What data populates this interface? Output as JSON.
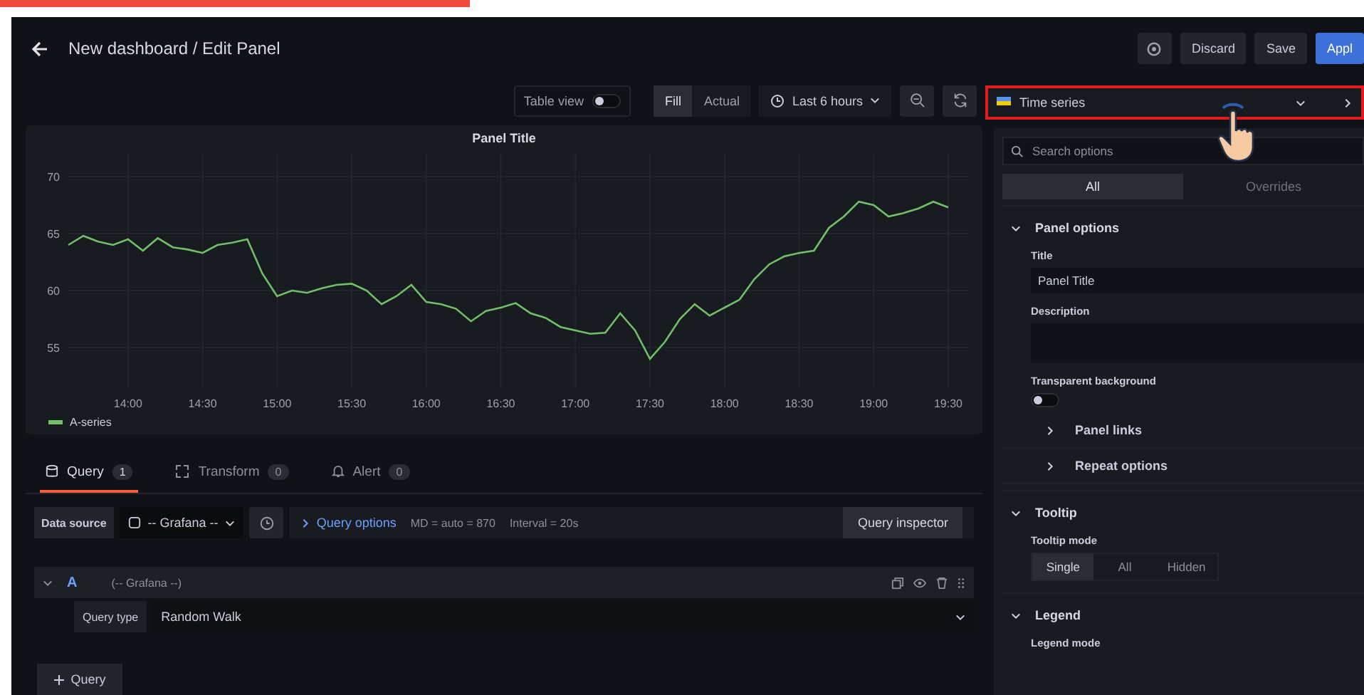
{
  "header": {
    "title": "New dashboard / Edit Panel",
    "buttons": [
      {
        "label": "Discard",
        "kind": "secondary"
      },
      {
        "label": "Save",
        "kind": "secondary"
      },
      {
        "label": "Appl",
        "kind": "primary"
      }
    ]
  },
  "toolbar": {
    "table_view": {
      "label": "Table view",
      "on": false
    },
    "size_modes": [
      {
        "label": "Fill",
        "selected": true
      },
      {
        "label": "Actual",
        "selected": false
      }
    ],
    "time_range": "Last 6 hours"
  },
  "visualization_picker": {
    "label": "Time series",
    "highlighted": true
  },
  "panel": {
    "title": "Panel Title",
    "chart_data": {
      "type": "line",
      "x": [
        13.6,
        13.7,
        13.8,
        13.9,
        14.0,
        14.1,
        14.2,
        14.3,
        14.4,
        14.5,
        14.6,
        14.7,
        14.8,
        14.9,
        15.0,
        15.1,
        15.2,
        15.3,
        15.4,
        15.5,
        15.6,
        15.7,
        15.8,
        15.9,
        16.0,
        16.1,
        16.2,
        16.3,
        16.4,
        16.5,
        16.6,
        16.7,
        16.8,
        16.9,
        17.0,
        17.1,
        17.2,
        17.3,
        17.4,
        17.5,
        17.6,
        17.7,
        17.8,
        17.9,
        18.0,
        18.1,
        18.2,
        18.3,
        18.4,
        18.5,
        18.6,
        18.7,
        18.8,
        18.9,
        19.0,
        19.1,
        19.2,
        19.3,
        19.4,
        19.5
      ],
      "series": [
        {
          "name": "A-series",
          "color": "#73bf69",
          "values": [
            64,
            64.8,
            64.3,
            64,
            64.5,
            63.5,
            64.6,
            63.8,
            63.6,
            63.3,
            64,
            64.2,
            64.5,
            61.5,
            59.5,
            60,
            59.8,
            60.2,
            60.5,
            60.6,
            60,
            58.8,
            59.5,
            60.5,
            59,
            58.8,
            58.4,
            57.3,
            58.2,
            58.5,
            58.9,
            58,
            57.6,
            56.8,
            56.5,
            56.2,
            56.3,
            58,
            56.5,
            54,
            55.5,
            57.5,
            58.8,
            57.8,
            58.5,
            59.2,
            61,
            62.3,
            63,
            63.3,
            63.5,
            65.5,
            66.5,
            67.8,
            67.5,
            66.5,
            66.8,
            67.2,
            67.8,
            67.3
          ]
        }
      ],
      "xlim": [
        13.6,
        19.5
      ],
      "ylim": [
        51.5,
        72
      ],
      "grid": true,
      "xticks": [
        {
          "value": 14,
          "label": "14:00"
        },
        {
          "value": 14.5,
          "label": "14:30"
        },
        {
          "value": 15,
          "label": "15:00"
        },
        {
          "value": 15.5,
          "label": "15:30"
        },
        {
          "value": 16,
          "label": "16:00"
        },
        {
          "value": 16.5,
          "label": "16:30"
        },
        {
          "value": 17,
          "label": "17:00"
        },
        {
          "value": 17.5,
          "label": "17:30"
        },
        {
          "value": 18,
          "label": "18:00"
        },
        {
          "value": 18.5,
          "label": "18:30"
        },
        {
          "value": 19,
          "label": "19:00"
        },
        {
          "value": 19.5,
          "label": "19:30"
        }
      ],
      "yticks": [
        55,
        60,
        65,
        70
      ]
    }
  },
  "query_tabs": [
    {
      "label": "Query",
      "count": "1",
      "selected": true
    },
    {
      "label": "Transform",
      "count": "0",
      "selected": false
    },
    {
      "label": "Alert",
      "count": "0",
      "selected": false
    }
  ],
  "data_source": {
    "label": "Data source",
    "value": "-- Grafana --",
    "query_options": "Query options",
    "meta": [
      "MD = auto = 870",
      "Interval = 20s"
    ],
    "inspector": "Query inspector"
  },
  "query": {
    "ref": "A",
    "source": "(-- Grafana --)",
    "expanded": true,
    "fields": [
      {
        "label": "Query type",
        "value": "Random Walk"
      }
    ]
  },
  "add_query": "Query",
  "options": {
    "search_placeholder": "Search options",
    "tabs": [
      {
        "label": "All",
        "selected": true
      },
      {
        "label": "Overrides",
        "selected": false
      }
    ],
    "sections": [
      {
        "title": "Panel options",
        "expanded": true,
        "items": [
          {
            "kind": "input",
            "label": "Title",
            "value": "Panel Title"
          },
          {
            "kind": "textarea",
            "label": "Description",
            "value": ""
          },
          {
            "kind": "switch",
            "label": "Transparent background",
            "on": false
          },
          {
            "kind": "sub",
            "label": "Panel links"
          },
          {
            "kind": "sub",
            "label": "Repeat options"
          }
        ]
      },
      {
        "title": "Tooltip",
        "expanded": true,
        "items": [
          {
            "kind": "radio",
            "label": "Tooltip mode",
            "options": [
              {
                "label": "Single",
                "selected": true
              },
              {
                "label": "All",
                "selected": false
              },
              {
                "label": "Hidden",
                "selected": false
              }
            ]
          }
        ]
      },
      {
        "title": "Legend",
        "expanded": true,
        "items": [
          {
            "kind": "label",
            "label": "Legend mode"
          }
        ]
      }
    ]
  }
}
